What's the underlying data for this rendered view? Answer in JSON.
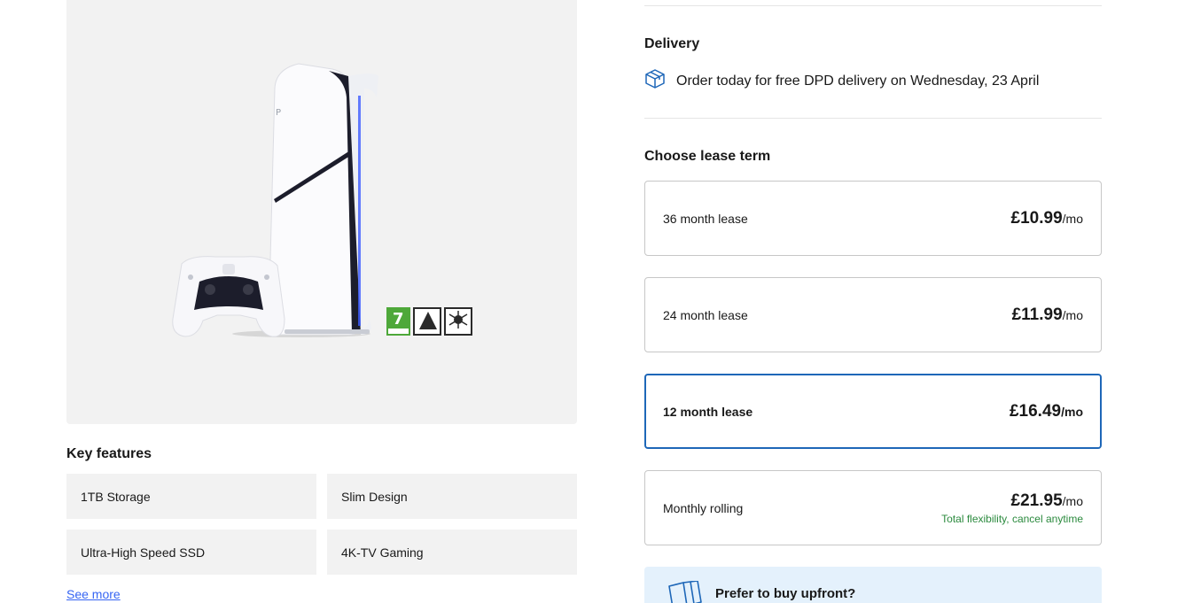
{
  "product": {
    "image_alt": "PlayStation 5 Slim Digital Edition console with DualSense controller",
    "rating_badges": [
      "7",
      "VIOLENCE",
      "FEAR"
    ]
  },
  "key_features": {
    "title": "Key features",
    "items": [
      "1TB Storage",
      "Slim Design",
      "Ultra-High Speed SSD",
      "4K-TV Gaming"
    ],
    "see_more": "See more"
  },
  "delivery": {
    "title": "Delivery",
    "text": "Order today for free DPD delivery on Wednesday, 23 April",
    "icon": "box-icon"
  },
  "lease": {
    "title": "Choose lease term",
    "selected_index": 2,
    "options": [
      {
        "label": "36 month lease",
        "price": "£10.99",
        "per": "/mo",
        "note": ""
      },
      {
        "label": "24 month lease",
        "price": "£11.99",
        "per": "/mo",
        "note": ""
      },
      {
        "label": "12 month lease",
        "price": "£16.49",
        "per": "/mo",
        "note": ""
      },
      {
        "label": "Monthly rolling",
        "price": "£21.95",
        "per": "/mo",
        "note": "Total flexibility, cancel anytime"
      }
    ]
  },
  "upfront": {
    "title": "Prefer to buy upfront?"
  },
  "colors": {
    "selected_border": "#1e67b8",
    "link": "#3665f3",
    "note_green": "#2b8a3e",
    "upfront_bg": "#e4f1fc"
  }
}
